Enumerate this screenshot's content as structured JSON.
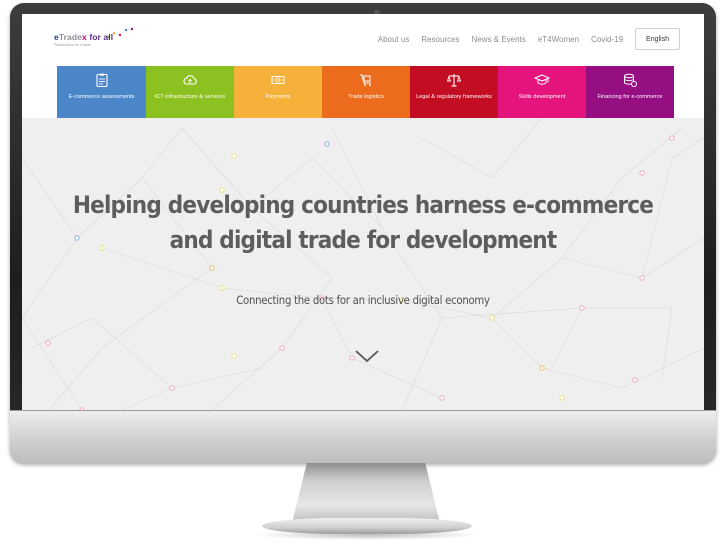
{
  "logo": {
    "e": "e",
    "trade": "Trade",
    "x": "x",
    "for_all": "for all",
    "subtitle": "Partnerships for e-trade"
  },
  "nav": {
    "links": [
      "About us",
      "Resources",
      "News & Events",
      "eT4Women",
      "Covid-19"
    ],
    "language": "English"
  },
  "tiles": [
    {
      "label": "E-commerce assessments",
      "color": "#4a86c8",
      "icon": "clipboard-icon"
    },
    {
      "label": "ICT infrastructure & services",
      "color": "#8dc021",
      "icon": "cloud-upload-icon"
    },
    {
      "label": "Payments",
      "color": "#f5b13a",
      "icon": "banknote-icon"
    },
    {
      "label": "Trade logistics",
      "color": "#ec6b1c",
      "icon": "cart-icon"
    },
    {
      "label": "Legal & regulatory frameworks",
      "color": "#c30d23",
      "icon": "scales-icon"
    },
    {
      "label": "Skills development",
      "color": "#e5147d",
      "icon": "graduation-cap-icon"
    },
    {
      "label": "Financing for e-commerce",
      "color": "#950f83",
      "icon": "coins-icon"
    }
  ],
  "hero": {
    "title_line1": "Helping developing countries harness e-commerce",
    "title_line2": "and digital trade for development",
    "subtitle": "Connecting the dots for an inclusive digital economy",
    "scroll_icon": "chevron-down-icon"
  }
}
